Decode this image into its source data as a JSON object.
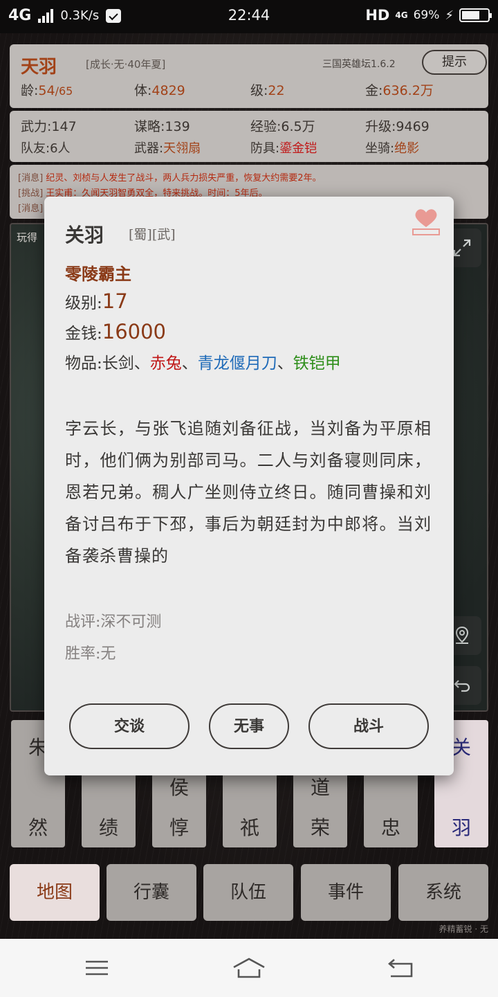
{
  "status_bar": {
    "network": "4G",
    "speed": "0.3K/s",
    "time": "22:44",
    "hd": "HD",
    "net_type": "4G",
    "battery": "69%",
    "battery_level": 0.69
  },
  "player": {
    "name": "天羽",
    "tag": "[成长·无·40年夏]",
    "version": "三国英雄坛1.6.2",
    "hint_button": "提示",
    "age_label": "龄:",
    "age_value": "54",
    "age_max": "/65",
    "body_label": "体:",
    "body_value": "4829",
    "level_label": "级:",
    "level_value": "22",
    "gold_label": "金:",
    "gold_value": "636.2万"
  },
  "attributes": {
    "force_label": "武力:",
    "force_value": "147",
    "strategy_label": "谋略:",
    "strategy_value": "139",
    "exp_label": "经验:",
    "exp_value": "6.5万",
    "upgrade_label": "升级:",
    "upgrade_value": "9469",
    "team_label": "队友:",
    "team_value": "6人",
    "weapon_label": "武器:",
    "weapon_value": "天翎扇",
    "armor_label": "防具:",
    "armor_value": "鎏金铠",
    "mount_label": "坐骑:",
    "mount_value": "绝影"
  },
  "messages": [
    {
      "kind": "[消息]",
      "text": "纪灵、刘桢与人发生了战斗，两人兵力损失严重，恢复大约需要2年。"
    },
    {
      "kind": "[挑战]",
      "text": "王实甫：久闻天羽智勇双全，特来挑战。时间：5年后。"
    },
    {
      "kind": "[消息]",
      "text": ""
    }
  ],
  "map": {
    "label": "玩得"
  },
  "dialog": {
    "name": "关羽",
    "faction": "[蜀]",
    "type": "[武]",
    "title": "零陵霸主",
    "level_label": "级别:",
    "level_value": "17",
    "money_label": "金钱:",
    "money_value": "16000",
    "items_label": "物品:",
    "items": [
      "长剑",
      "赤兔",
      "青龙偃月刀",
      "铁铠甲"
    ],
    "item_sep": "、",
    "bio": "字云长，与张飞追随刘备征战，当刘备为平原相时，他们俩为别部司马。二人与刘备寝则同床，恩若兄弟。稠人广坐则侍立终日。随同曹操和刘备讨吕布于下邳，事后为朝廷封为中郎将。当刘备袭杀曹操的",
    "rating_label": "战评:",
    "rating_value": "深不可测",
    "winrate_label": "胜率:",
    "winrate_value": "无",
    "btn_talk": "交谈",
    "btn_nothing": "无事",
    "btn_fight": "战斗"
  },
  "cards": [
    {
      "top": "朱",
      "bottom": "然"
    },
    {
      "top": "",
      "bottom": "绩"
    },
    {
      "top": "侯",
      "bottom": "惇"
    },
    {
      "top": "",
      "bottom": "祇"
    },
    {
      "top": "道",
      "bottom": "荣"
    },
    {
      "top": "",
      "bottom": "忠"
    },
    {
      "top": "关",
      "bottom": "羽"
    }
  ],
  "nav": {
    "map": "地图",
    "bag": "行囊",
    "team": "队伍",
    "events": "事件",
    "system": "系统"
  },
  "motto": "养精蓄锐 · 无"
}
